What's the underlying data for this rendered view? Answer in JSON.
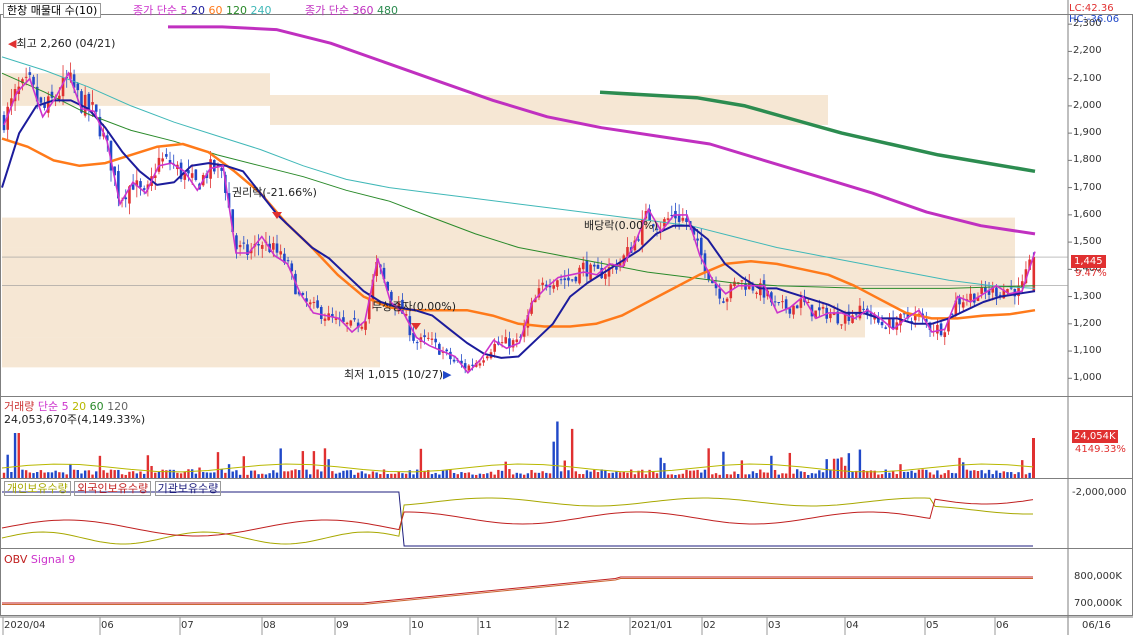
{
  "colors": {
    "up": "#e03030",
    "down": "#2048c8",
    "ma5": "#cc33cc",
    "ma20": "#1c1c9c",
    "ma60": "#ff7a1a",
    "ma120": "#2a8a2a",
    "ma240": "#40b8b8",
    "ma360": "#c030c0",
    "ma480": "#2c8c50",
    "band": "#f5e3cc",
    "frame": "#7f7f7f",
    "grid": "#d9d9d9"
  },
  "header": {
    "title": "한창 매물대 수(10)",
    "ma_legend_a": "종가 단순 5",
    "ma_periods_a": [
      "20",
      "60",
      "120",
      "240"
    ],
    "ma_legend_b": "종가 단순 360",
    "ma_period_b": "480",
    "lc": "LC:42.36",
    "hc": "HC:-36.06"
  },
  "price_panel": {
    "y_ticks": [
      "2,300",
      "2,200",
      "2,100",
      "2,000",
      "1,900",
      "1,800",
      "1,700",
      "1,600",
      "1,500",
      "1,400",
      "1,300",
      "1,200",
      "1,100",
      "1,000"
    ],
    "annotations": {
      "high": "최고 2,260 (04/21)",
      "low": "최저 1,015 (10/27)",
      "rights": "권리락(-21.66%)",
      "bonus": "무상증자(0.00%)",
      "dividend": "배당락(0.00%)"
    },
    "last_price": "1,445",
    "last_change": "9.47%"
  },
  "volume_panel": {
    "legend_label": "거래량",
    "legend_ma": [
      "단순 5",
      "20",
      "60",
      "120"
    ],
    "summary": "24,053,670주(4,149.33%)",
    "last_volume": "24,054K",
    "last_pct": "4149.33%"
  },
  "holdings_panel": {
    "legend": [
      "개인보유수량",
      "외국인보유수량",
      "기관보유수량"
    ],
    "y_tick": "-2,000,000"
  },
  "obv_panel": {
    "legend": [
      "OBV",
      "Signal 9"
    ],
    "y_ticks": [
      "800,000K",
      "700,000K"
    ]
  },
  "x_axis": {
    "ticks": [
      "2020/04",
      "06",
      "07",
      "08",
      "09",
      "10",
      "11",
      "12",
      "2021/01",
      "02",
      "03",
      "04",
      "05",
      "06"
    ],
    "right_label": "06/16"
  },
  "chart_data": [
    {
      "type": "candlestick",
      "title": "한창 매물대 수(10)",
      "x_ticks": [
        "2020/04",
        "06",
        "07",
        "08",
        "09",
        "10",
        "11",
        "12",
        "2021/01",
        "02",
        "03",
        "04",
        "05",
        "06"
      ],
      "y_ticks": [
        2300,
        2200,
        2100,
        2000,
        1900,
        1800,
        1700,
        1600,
        1500,
        1400,
        1300,
        1200,
        1100,
        1000
      ],
      "ylim": [
        935,
        2330
      ],
      "close_path": [
        1950,
        2050,
        2080,
        1980,
        2030,
        2100,
        2010,
        1980,
        1850,
        1660,
        1720,
        1660,
        1800,
        1790,
        1740,
        1710,
        1770,
        1760,
        1480,
        1460,
        1500,
        1470,
        1420,
        1290,
        1260,
        1230,
        1200,
        1190,
        1210,
        1420,
        1300,
        1240,
        1130,
        1140,
        1100,
        1060,
        1040,
        1070,
        1120,
        1130,
        1130,
        1260,
        1350,
        1370,
        1360,
        1410,
        1380,
        1400,
        1430,
        1500,
        1600,
        1560,
        1600,
        1580,
        1470,
        1360,
        1290,
        1360,
        1340,
        1320,
        1260,
        1260,
        1280,
        1240,
        1240,
        1220,
        1240,
        1250,
        1200,
        1200,
        1220,
        1230,
        1190,
        1180,
        1280,
        1300,
        1310,
        1320,
        1330,
        1320,
        1445
      ],
      "ma_paths": {
        "ma20": [
          1700,
          1900,
          2000,
          2020,
          2020,
          1990,
          1920,
          1830,
          1760,
          1710,
          1720,
          1780,
          1790,
          1780,
          1760,
          1680,
          1600,
          1540,
          1480,
          1440,
          1380,
          1320,
          1280,
          1260,
          1250,
          1230,
          1180,
          1130,
          1090,
          1075,
          1080,
          1140,
          1200,
          1300,
          1350,
          1390,
          1430,
          1470,
          1530,
          1560,
          1560,
          1510,
          1420,
          1370,
          1330,
          1330,
          1310,
          1290,
          1270,
          1240,
          1240,
          1220,
          1220,
          1200,
          1200,
          1220,
          1250,
          1280,
          1300,
          1310,
          1320
        ],
        "ma60": [
          1880,
          1850,
          1800,
          1780,
          1790,
          1820,
          1850,
          1860,
          1830,
          1760,
          1680,
          1570,
          1480,
          1380,
          1300,
          1260,
          1250,
          1250,
          1250,
          1230,
          1200,
          1190,
          1190,
          1200,
          1230,
          1280,
          1330,
          1380,
          1420,
          1430,
          1420,
          1400,
          1380,
          1340,
          1290,
          1240,
          1220,
          1220,
          1230,
          1235,
          1250
        ],
        "ma120": [
          2120,
          2050,
          1970,
          1910,
          1870,
          1820,
          1780,
          1740,
          1690,
          1650,
          1590,
          1530,
          1480,
          1450,
          1420,
          1390,
          1370,
          1350,
          1340,
          1335,
          1330,
          1330,
          1330,
          1335,
          1340
        ],
        "ma240": [
          2180,
          2130,
          2070,
          2000,
          1940,
          1890,
          1840,
          1780,
          1730,
          1700,
          1680,
          1660,
          1640,
          1620,
          1600,
          1580,
          1560,
          1520,
          1480,
          1450,
          1420,
          1390,
          1360,
          1340,
          1330
        ],
        "ma360": [
          2290,
          2290,
          2280,
          2230,
          2160,
          2090,
          2020,
          1960,
          1920,
          1890,
          1860,
          1800,
          1740,
          1680,
          1610,
          1560,
          1530
        ],
        "ma480": [
          2050,
          2040,
          2030,
          2000,
          1950,
          1900,
          1860,
          1820,
          1790,
          1760
        ]
      },
      "volume_profile_bands": [
        [
          2000,
          2120
        ],
        [
          1930,
          2040
        ],
        [
          1480,
          1590
        ],
        [
          1370,
          1480
        ],
        [
          1260,
          1370
        ],
        [
          1150,
          1260
        ],
        [
          1040,
          1150
        ]
      ]
    },
    {
      "type": "bar",
      "title": "거래량",
      "series": [
        {
          "name": "거래량"
        },
        {
          "name": "단순 5"
        },
        {
          "name": "20"
        },
        {
          "name": "60"
        },
        {
          "name": "120"
        }
      ],
      "last_value": "24,054K"
    },
    {
      "type": "line",
      "series": [
        {
          "name": "개인보유수량"
        },
        {
          "name": "외국인보유수량"
        },
        {
          "name": "기관보유수량"
        }
      ],
      "y_ticks": [
        "-2,000,000"
      ]
    },
    {
      "type": "line",
      "series": [
        {
          "name": "OBV"
        },
        {
          "name": "Signal 9"
        }
      ],
      "y_ticks": [
        "800,000K",
        "700,000K"
      ]
    }
  ]
}
